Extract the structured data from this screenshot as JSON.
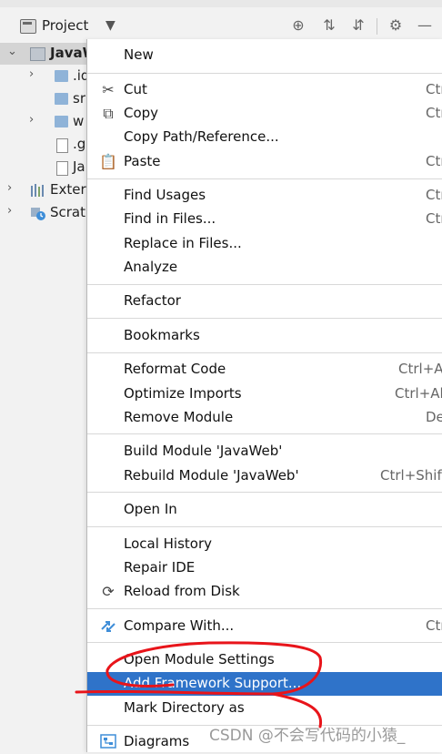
{
  "toolbar": {
    "project_label": "Project",
    "icons": [
      "crosshair-icon",
      "expand-all-icon",
      "collapse-all-icon",
      "gear-icon",
      "minimize-icon"
    ]
  },
  "tree": {
    "items": [
      {
        "label": "JavaW",
        "selected": true,
        "icon": "module-folder-icon"
      },
      {
        "label": ".id",
        "icon": "folder-icon"
      },
      {
        "label": "sr",
        "icon": "folder-icon"
      },
      {
        "label": "w",
        "icon": "web-folder-icon"
      },
      {
        "label": ".g",
        "icon": "gitignore-file-icon"
      },
      {
        "label": "Ja",
        "icon": "iml-file-icon"
      },
      {
        "label": "Exter",
        "icon": "libraries-icon"
      },
      {
        "label": "Scrat",
        "icon": "scratches-icon"
      }
    ]
  },
  "menu": {
    "new": {
      "label": "New"
    },
    "cut": {
      "label": "Cut",
      "shortcut": "Ctr"
    },
    "copy": {
      "label": "Copy",
      "shortcut": "Ctr"
    },
    "copy_path": {
      "label": "Copy Path/Reference..."
    },
    "paste": {
      "label": "Paste",
      "shortcut": "Ctr"
    },
    "find_usages": {
      "label": "Find Usages",
      "shortcut": "Ctr"
    },
    "find_in_files": {
      "label": "Find in Files...",
      "shortcut": "Ctr"
    },
    "replace_in_files": {
      "label": "Replace in Files..."
    },
    "analyze": {
      "label": "Analyze"
    },
    "refactor": {
      "label": "Refactor"
    },
    "bookmarks": {
      "label": "Bookmarks"
    },
    "reformat_code": {
      "label": "Reformat Code",
      "shortcut": "Ctrl+A"
    },
    "optimize_imports": {
      "label": "Optimize Imports",
      "shortcut": "Ctrl+Al"
    },
    "remove_module": {
      "label": "Remove Module",
      "shortcut": "De"
    },
    "build_module": {
      "label": "Build Module 'JavaWeb'"
    },
    "rebuild_module": {
      "label": "Rebuild Module 'JavaWeb'",
      "shortcut": "Ctrl+Shift"
    },
    "open_in": {
      "label": "Open In"
    },
    "local_history": {
      "label": "Local History"
    },
    "repair_ide": {
      "label": "Repair IDE"
    },
    "reload_from_disk": {
      "label": "Reload from Disk"
    },
    "compare_with": {
      "label": "Compare With...",
      "shortcut": "Ctr"
    },
    "open_module_settings": {
      "label": "Open Module Settings"
    },
    "add_framework_support": {
      "label": "Add Framework Support...",
      "highlighted": true
    },
    "mark_directory_as": {
      "label": "Mark Directory as"
    },
    "diagrams": {
      "label": "Diagrams"
    }
  },
  "watermark": "CSDN @不会写代码的小猿_",
  "colors": {
    "highlight": "#2f73c9",
    "annotation": "#e8141a",
    "menu_bg": "#ffffff",
    "panel_bg": "#f2f2f2"
  }
}
